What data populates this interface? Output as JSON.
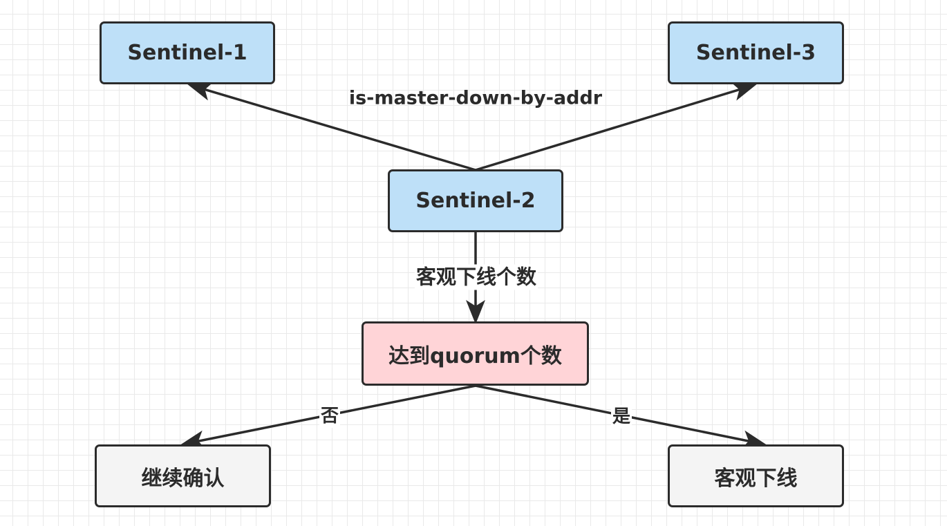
{
  "nodes": {
    "sentinel1": "Sentinel-1",
    "sentinel2": "Sentinel-2",
    "sentinel3": "Sentinel-3",
    "quorum": "达到quorum个数",
    "continue_confirm": "继续确认",
    "objective_down": "客观下线"
  },
  "edges": {
    "ask_label": "is-master-down-by-addr",
    "count_label": "客观下线个数",
    "no_label": "否",
    "yes_label": "是"
  },
  "colors": {
    "sentinel_fill": "#bee0f8",
    "quorum_fill": "#ffd4d7",
    "result_fill": "#f4f4f4",
    "stroke": "#2b2b2b"
  }
}
